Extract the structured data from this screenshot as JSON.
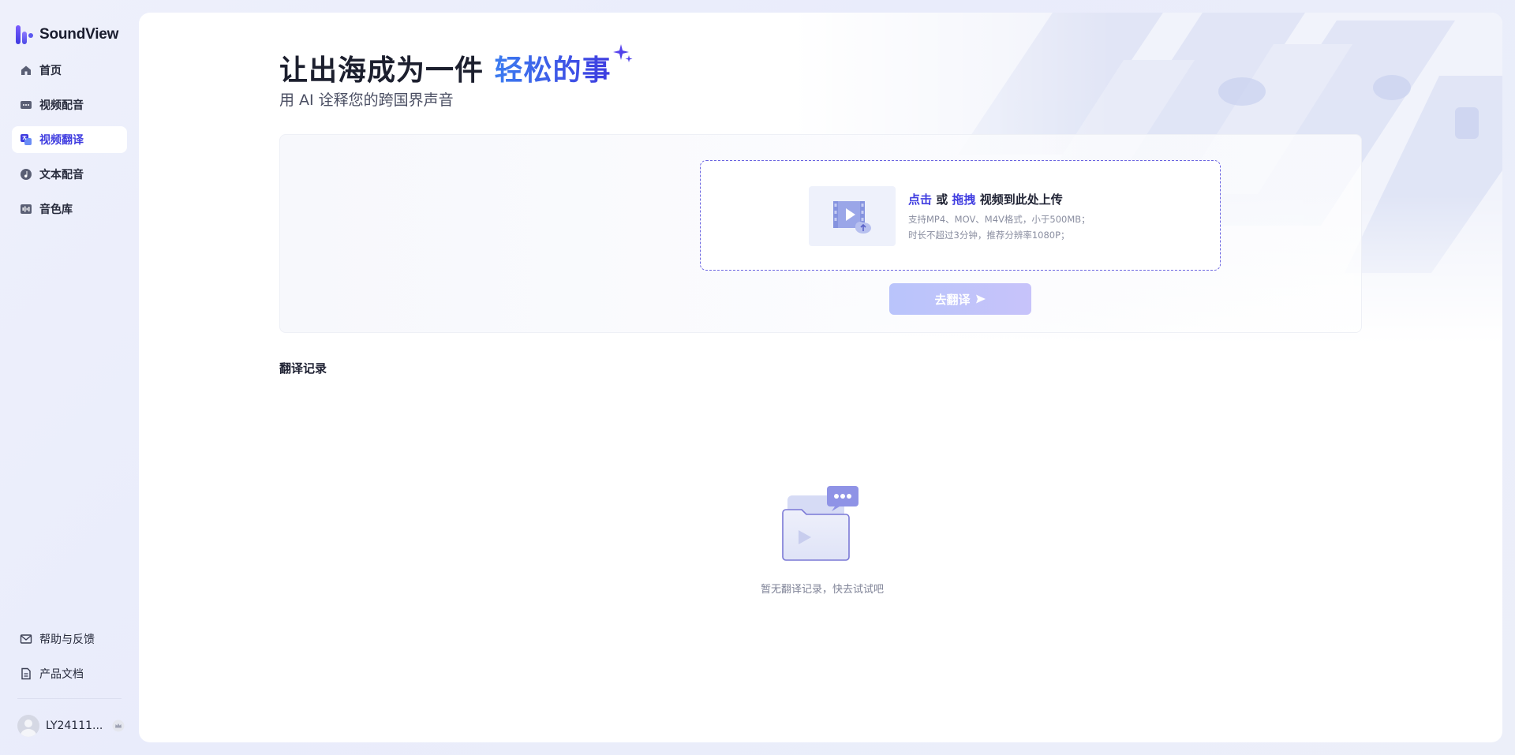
{
  "app": {
    "name": "SoundView"
  },
  "sidebar": {
    "items": [
      {
        "label": "首页",
        "icon": "home-icon",
        "active": false
      },
      {
        "label": "视频配音",
        "icon": "video-dub-icon",
        "active": false
      },
      {
        "label": "视频翻译",
        "icon": "video-translate-icon",
        "active": true
      },
      {
        "label": "文本配音",
        "icon": "text-dub-icon",
        "active": false
      },
      {
        "label": "音色库",
        "icon": "voice-library-icon",
        "active": false
      }
    ],
    "bottom_items": [
      {
        "label": "帮助与反馈",
        "icon": "mail-icon"
      },
      {
        "label": "产品文档",
        "icon": "document-icon"
      }
    ],
    "user": {
      "name": "LY24111...",
      "icon": "crown-icon"
    }
  },
  "hero": {
    "title_plain": "让出海成为一件 ",
    "title_accent": "轻松的事",
    "subtitle": "用 AI 诠释您的跨国界声音"
  },
  "upload": {
    "click_label": "点击",
    "or_label": " 或 ",
    "drag_label": "拖拽",
    "suffix_label": " 视频到此处上传",
    "note_formats": "支持MP4、MOV、M4V格式，小于500MB；",
    "note_duration": "时长不超过3分钟，推荐分辨率1080P；",
    "button_label": "去翻译"
  },
  "records": {
    "title": "翻译记录",
    "empty_text": "暂无翻译记录，快去试试吧"
  },
  "colors": {
    "accent": "#3f3ce0",
    "accent_blue": "#3c7cf0"
  }
}
